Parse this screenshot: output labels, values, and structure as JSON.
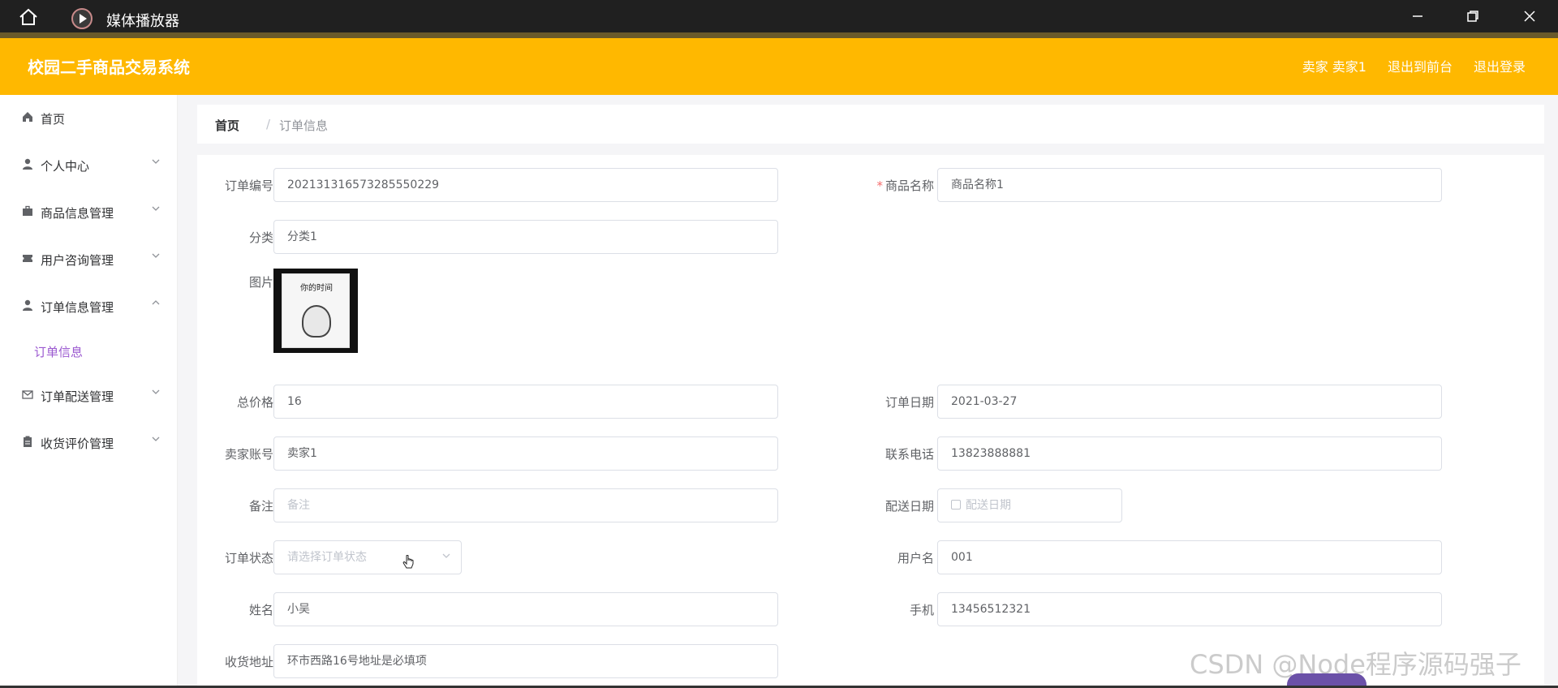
{
  "player": {
    "title": "媒体播放器"
  },
  "header": {
    "brand": "校园二手商品交易系统",
    "user_label": "卖家 卖家1",
    "to_front": "退出到前台",
    "logout": "退出登录"
  },
  "sidebar": {
    "items": [
      {
        "label": "首页",
        "icon": "home-icon"
      },
      {
        "label": "个人中心",
        "icon": "user-icon"
      },
      {
        "label": "商品信息管理",
        "icon": "briefcase-icon"
      },
      {
        "label": "用户咨询管理",
        "icon": "ticket-icon"
      },
      {
        "label": "订单信息管理",
        "icon": "user-icon"
      },
      {
        "label": "订单配送管理",
        "icon": "mail-icon"
      },
      {
        "label": "收货评价管理",
        "icon": "clipboard-icon"
      }
    ],
    "sub_item": "订单信息"
  },
  "breadcrumb": {
    "home": "首页",
    "separator": "/",
    "current": "订单信息"
  },
  "form": {
    "order_no": {
      "label": "订单编号",
      "value": "202131316573285550229"
    },
    "product_name": {
      "label": "商品名称",
      "value": "商品名称1",
      "required": "*"
    },
    "category": {
      "label": "分类",
      "value": "分类1"
    },
    "image": {
      "label": "图片",
      "book_title": "你的时间"
    },
    "total_price": {
      "label": "总价格",
      "value": "16"
    },
    "order_date": {
      "label": "订单日期",
      "value": "2021-03-27"
    },
    "seller_account": {
      "label": "卖家账号",
      "value": "卖家1"
    },
    "contact_phone": {
      "label": "联系电话",
      "value": "13823888881"
    },
    "remark": {
      "label": "备注",
      "placeholder": "备注"
    },
    "delivery_date": {
      "label": "配送日期",
      "placeholder": "配送日期"
    },
    "order_status": {
      "label": "订单状态",
      "placeholder": "请选择订单状态"
    },
    "username": {
      "label": "用户名",
      "value": "001"
    },
    "name": {
      "label": "姓名",
      "value": "小吴"
    },
    "mobile": {
      "label": "手机",
      "value": "13456512321"
    },
    "address": {
      "label": "收货地址",
      "value": "环市西路16号地址是必填项"
    }
  },
  "watermark": "CSDN @Node程序源码强子"
}
